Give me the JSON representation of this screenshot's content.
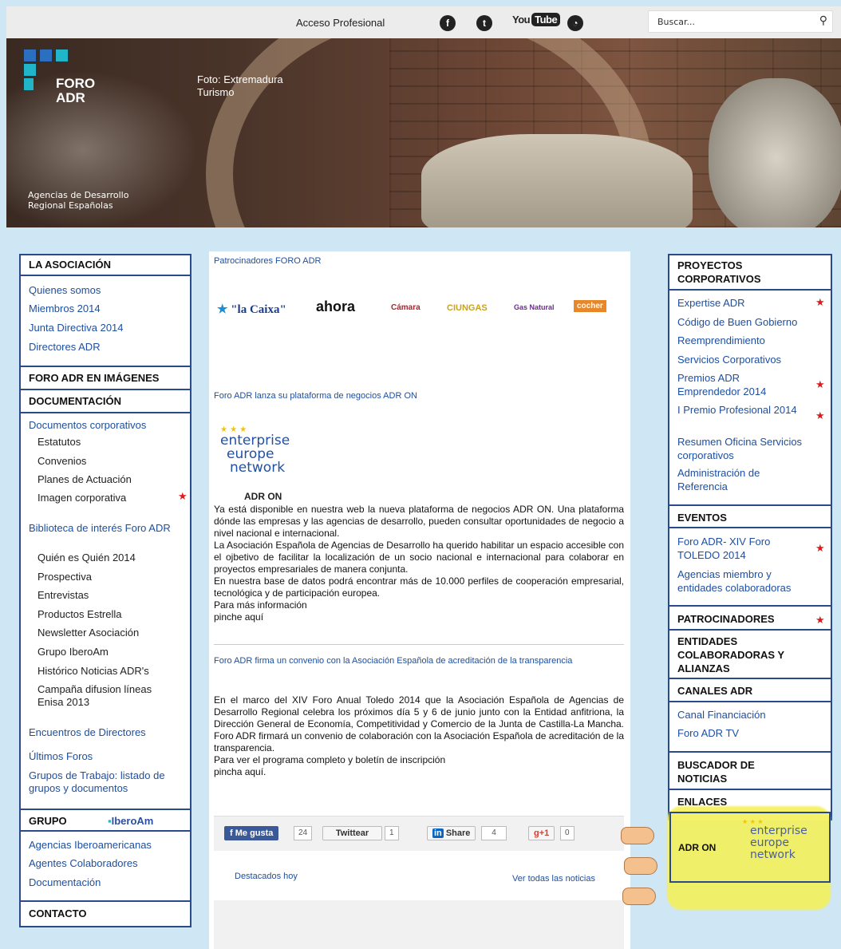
{
  "topbar": {
    "acceso_label": "Acceso Profesional",
    "social": [
      {
        "name": "facebook",
        "icon": "f"
      },
      {
        "name": "twitter",
        "icon": "t"
      },
      {
        "name": "youtube",
        "label_a": "You",
        "label_b": "Tube"
      },
      {
        "name": "flickr",
        "icon": "◔"
      }
    ],
    "search_placeholder": "Buscar..."
  },
  "header": {
    "logo_line1": "FORO",
    "logo_line2": "ADR",
    "photo_credit": "Foto: Extremadura Turismo",
    "subtitle": "Agencias de Desarrollo Regional Españolas",
    "logo_colors": [
      "#2b6fc0",
      "#2b6fc0",
      "#21b5c9",
      "#21b5c9",
      "#21b5c9"
    ]
  },
  "left_nav": {
    "la_asociacion": "LA ASOCIACIÓN",
    "asociacion_items": [
      "Quienes somos",
      "Miembros 2014",
      "Junta Directiva 2014",
      "Directores ADR"
    ],
    "foro_imagenes": "FORO ADR EN IMÁGENES",
    "documentacion": "DOCUMENTACIÓN",
    "doc_corporativos": "Documentos corporativos",
    "doc_sub": [
      "Estatutos",
      "Convenios",
      "Planes de Actuación",
      "Imagen corporativa"
    ],
    "biblioteca": "Biblioteca de interés Foro ADR",
    "bib_sub": [
      "Quién es Quién 2014",
      "Prospectiva",
      "Entrevistas",
      "Productos Estrella",
      "Newsletter Asociación",
      "Grupo IberoAm",
      "Histórico Noticias ADR's",
      "Campaña difusion líneas Enisa 2013"
    ],
    "encuentros": "Encuentros de Directores",
    "ultimos_foros": "Últimos Foros",
    "grupos_trabajo": "Grupos de Trabajo: listado de grupos y documentos",
    "grupo": "GRUPO",
    "iberoam_logo": "IberoAm",
    "grupo_items": [
      "Agencias Iberoamericanas",
      "Agentes Colaboradores",
      "Documentación"
    ],
    "contacto": "CONTACTO"
  },
  "main": {
    "patrocinadores_link": "Patrocinadores FORO ADR",
    "sponsors": [
      "\"la Caixa\"",
      "ahora",
      "Cámara",
      "CIUNGAS",
      "Gas Natural",
      "cocher"
    ],
    "news1_title": "Foro ADR lanza su plataforma de negocios ADR ON",
    "een_lines": [
      "enterprise",
      "europe",
      "network"
    ],
    "adr_on_caption": "ADR ON",
    "news1_body": "Ya está disponible en nuestra web  la nueva plataforma de negocios ADR ON. Una plataforma dónde  las empresas y las agencias de desarrollo, pueden consultar oportunidades de negocio a nivel nacional e internacional.\nLa Asociación Española de Agencias de Desarrollo ha querido habilitar un espacio accesible  con el  ojbetivo de facilitar la localización de un socio nacional e internacional para colaborar en proyectos empresariales de manera conjunta.\nEn nuestra base de datos podrá encontrar más de 10.000 perfiles de cooperación empresarial, tecnológica y de participación europea.\nPara más información\npinche aquí",
    "news2_title": "Foro ADR firma un convenio con la Asociación Española de acreditación de la transparencia",
    "news2_body": "En el marco del XIV Foro Anual Toledo 2014 que la Asociación Española de Agencias de Desarrollo Regional celebra los próximos día 5 y 6 de junio junto con la Entidad anfitriona, la Dirección General de Economía, Competitividad y Comercio de la Junta de Castilla-La Mancha. Foro ADR firmará un convenio de colaboración con la Asociación Española de acreditación de la transparencia.\nPara ver el programa completo y boletín de inscripción\npincha aquí.",
    "share": {
      "me_gusta": "Me gusta",
      "me_gusta_count": "24",
      "twittear": "Twittear",
      "twittear_count": "1",
      "share": "Share",
      "share_count": "4",
      "gplus": "+1",
      "gplus_count": "0"
    },
    "destacados": "Destacados hoy",
    "ver_todas": "Ver todas las noticias"
  },
  "right_nav": {
    "proyectos": "PROYECTOS CORPORATIVOS",
    "proyectos_items": [
      "Expertise ADR",
      "Código de Buen Gobierno",
      "Reemprendimiento",
      "Servicios Corporativos",
      "Premios ADR Emprendedor 2014",
      "I Premio Profesional 2014",
      "Resumen Oficina Servicios corporativos",
      "Administración de Referencia"
    ],
    "eventos": "EVENTOS",
    "eventos_items": [
      "Foro ADR- XIV Foro TOLEDO 2014",
      "Agencias miembro y entidades colaboradoras"
    ],
    "patrocinadores": "PATROCINADORES",
    "entidades": "ENTIDADES COLABORADORAS Y ALIANZAS",
    "canales": "CANALES ADR",
    "canales_items": [
      "Canal Financiación",
      "Foro ADR TV"
    ],
    "buscador": "BUSCADOR DE NOTICIAS",
    "enlaces": "ENLACES",
    "adr_on": "ADR ON",
    "een_lines": [
      "enterprise",
      "europe",
      "network"
    ],
    "highlight_color": "#f4f15a",
    "star_color": "#e01a1a"
  }
}
